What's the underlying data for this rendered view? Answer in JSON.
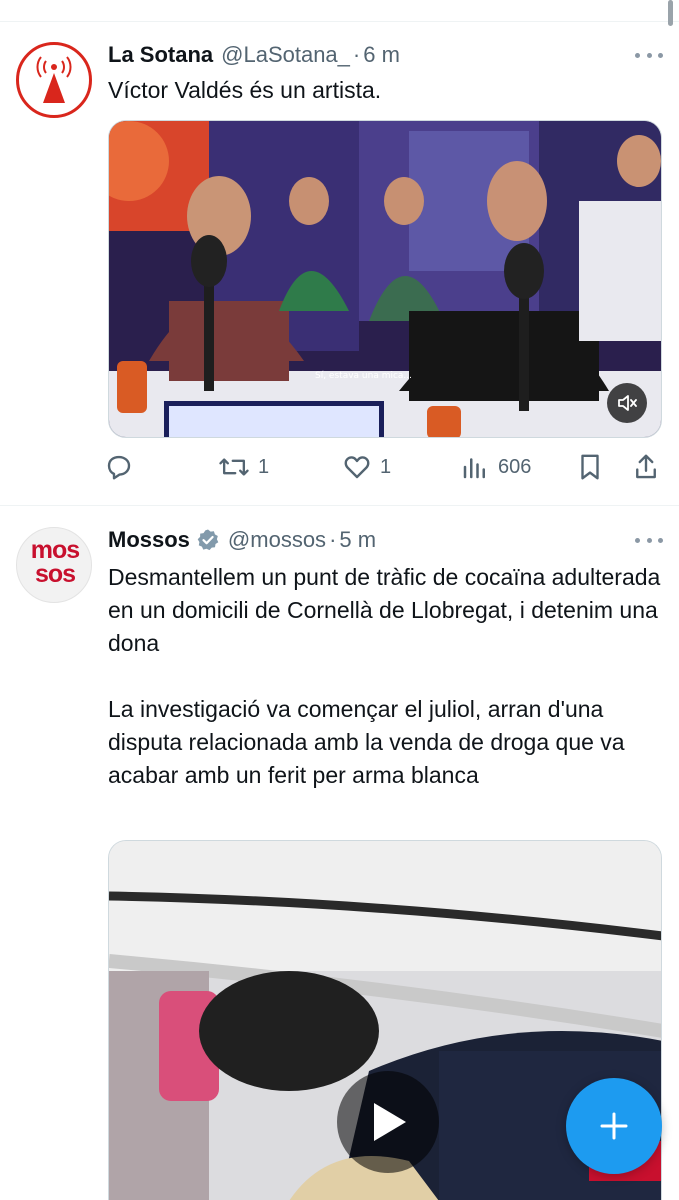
{
  "tweets": [
    {
      "display_name": "La Sotana",
      "handle": "@LaSotana_",
      "separator": "·",
      "time": "6 m",
      "verified": false,
      "avatar_icon": "radio-tower-logo",
      "text": "Víctor Valdés és un artista.",
      "media": {
        "type": "video",
        "caption": "Sí, estava una mica...",
        "overlay_icon": "mute-icon"
      },
      "actions": {
        "replies": "",
        "retweets": "1",
        "likes": "1",
        "views": "606"
      }
    },
    {
      "display_name": "Mossos",
      "handle": "@mossos",
      "separator": "·",
      "time": "5 m",
      "verified": true,
      "avatar_logo_line1": "mos",
      "avatar_logo_line2": "sos",
      "text": "Desmantellem un punt de tràfic de cocaïna adulterada en un domicili de Cornellà de Llobregat, i detenim una dona\n\nLa investigació va començar el juliol, arran d'una disputa relacionada amb la venda de droga que va acabar amb un ferit per arma blanca",
      "media": {
        "type": "video",
        "overlay_icon": "play-icon"
      }
    }
  ],
  "fab": {
    "icon": "plus-icon"
  },
  "colors": {
    "accent": "#1d9bf0",
    "secondary_text": "#536471",
    "brand_red": "#c8102e",
    "lasotana_red": "#d9261c"
  }
}
